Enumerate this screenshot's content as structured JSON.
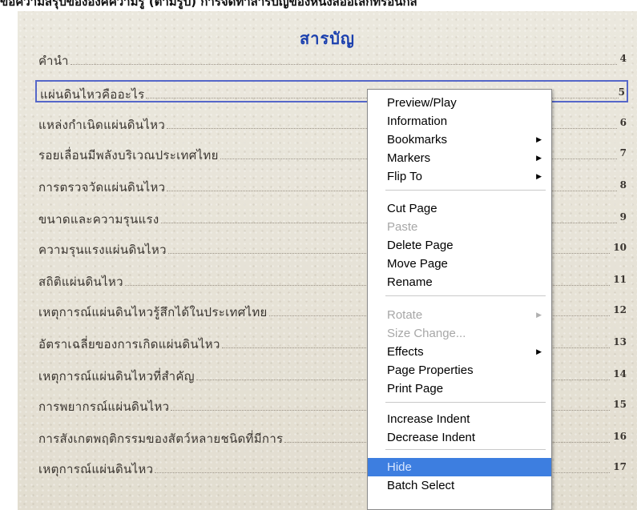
{
  "top_strip": "ขอความสรุปขององค์ความรู้ (ตามรูป) การจัดทำสารบัญของหนังสืออิเล็กทรอนิกส์",
  "toc": {
    "title": "สารบัญ",
    "entries": [
      {
        "title": "คำนำ",
        "page": "4"
      },
      {
        "title": "แผ่นดินไหวคืออะไร",
        "page": "5"
      },
      {
        "title": "แหล่งกำเนิดแผ่นดินไหว",
        "page": "6"
      },
      {
        "title": "รอยเลื่อนมีพลังบริเวณประเทศไทย",
        "page": "7"
      },
      {
        "title": "การตรวจวัดแผ่นดินไหว",
        "page": "8"
      },
      {
        "title": "ขนาดและความรุนแรง",
        "page": "9"
      },
      {
        "title": "ความรุนแรงแผ่นดินไหว",
        "page": "10"
      },
      {
        "title": "สถิติแผ่นดินไหว",
        "page": "11"
      },
      {
        "title": "เหตุการณ์แผ่นดินไหวรู้สึกได้ในประเทศไทย",
        "page": "12"
      },
      {
        "title": "อัตราเฉลี่ยของการเกิดแผ่นดินไหว",
        "page": "13"
      },
      {
        "title": "เหตุการณ์แผ่นดินไหวที่สำคัญ",
        "page": "14"
      },
      {
        "title": "การพยากรณ์แผ่นดินไหว",
        "page": "15"
      },
      {
        "title": "การสังเกตพฤติกรรมของสัตว์หลายชนิดที่มีการ",
        "page": "16"
      },
      {
        "title": "เหตุการณ์แผ่นดินไหว",
        "page": "17"
      }
    ]
  },
  "context_menu": {
    "items": [
      {
        "label": "Preview/Play"
      },
      {
        "label": "Information"
      },
      {
        "label": "Bookmarks",
        "submenu": true
      },
      {
        "label": "Markers",
        "submenu": true
      },
      {
        "label": "Flip To",
        "submenu": true
      },
      {
        "label": "Cut Page"
      },
      {
        "label": "Paste",
        "disabled": true
      },
      {
        "label": "Delete Page"
      },
      {
        "label": "Move Page"
      },
      {
        "label": "Rename"
      },
      {
        "label": "Rotate",
        "disabled": true,
        "submenu": true
      },
      {
        "label": "Size Change...",
        "disabled": true
      },
      {
        "label": "Effects",
        "submenu": true
      },
      {
        "label": "Page Properties"
      },
      {
        "label": "Print Page"
      },
      {
        "label": "Increase Indent"
      },
      {
        "label": "Decrease Indent"
      },
      {
        "label": "Hide",
        "highlighted": true
      },
      {
        "label": "Batch Select"
      }
    ],
    "submenu_arrow": "▶"
  },
  "colors": {
    "title": "#1a3fae",
    "selection_border": "#5567c9",
    "menu_highlight": "#3d7ee0",
    "paper": "#e7e3d7"
  }
}
